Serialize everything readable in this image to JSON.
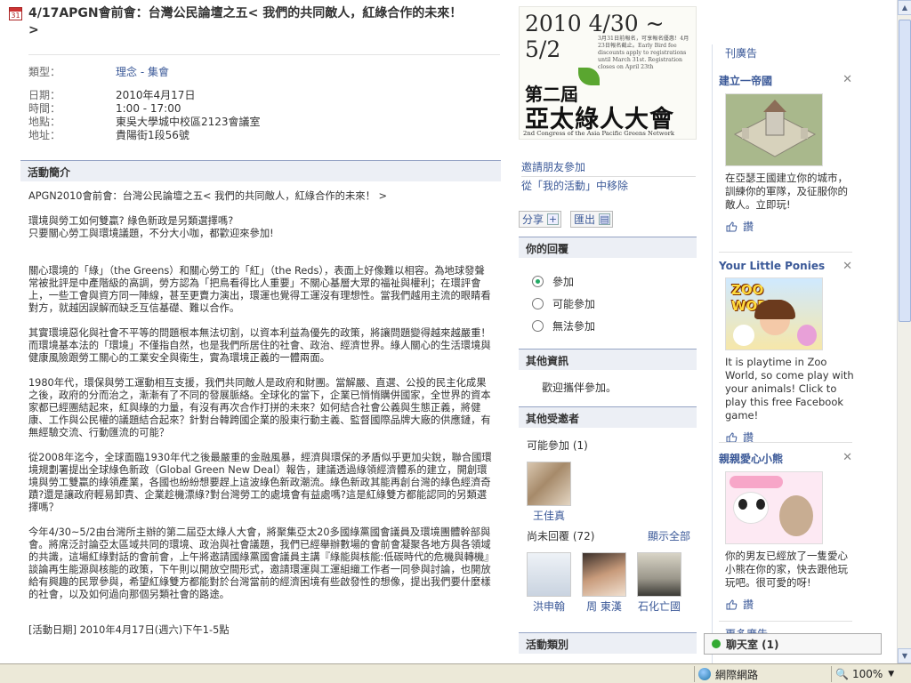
{
  "event": {
    "icon_day": "31",
    "title": "4/17APGN會前會：台灣公民論壇之五< 我們的共同敵人，紅綠合作的未來！ >",
    "fields": [
      {
        "label": "類型：",
        "value": "理念 - 集會",
        "link": true
      },
      {
        "label": "日期：",
        "value": "2010年4月17日",
        "link": false
      },
      {
        "label": "時間：",
        "value": "1:00 - 17:00",
        "link": false
      },
      {
        "label": "地點：",
        "value": "東吳大學城中校區2123會議室",
        "link": false
      },
      {
        "label": "地址：",
        "value": "貴陽街1段56號",
        "link": false
      }
    ]
  },
  "description": {
    "header": "活動簡介",
    "paragraphs": [
      "APGN2010會前會：台灣公民論壇之五< 我們的共同敵人，紅綠合作的未來！ >",
      "環境與勞工如何雙贏? 綠色新政是另類選擇嗎?",
      "只要關心勞工與環境議題，不分大小咖，都歡迎來參加!",
      "關心環境的「綠」（the Greens）和關心勞工的「紅」（the Reds），表面上好像難以相容。為地球發聲常被批評是中產階級的高調，勞方認為「把鳥看得比人重要」不關心基層大眾的福祉與權利；在環評會上，一些工會與資方同一陣線，甚至更賣力演出，環運也覺得工運沒有理想性。當我們越用主流的眼睛看對方，就越因誤解而缺乏互信基礎、難以合作。",
      "其實環境惡化與社會不平等的問題根本無法切割，以資本利益為優先的政策，將讓問題變得越來越嚴重！而環境基本法的「環境」不僅指自然，也是我們所居住的社會、政治、經濟世界。綠人關心的生活環境與健康風險跟勞工關心的工業安全與衛生，實為環境正義的一體兩面。",
      "1980年代，環保與勞工運動相互支援，我們共同敵人是政府和財團。當解嚴、直選、公投的民主化成果之後，政府的分而治之，漸漸有了不同的發展脈絡。全球化的當下，企業已悄悄購併國家，全世界的資本家都已經團結起來，紅與綠的力量，有沒有再次合作打拼的未來？如何結合社會公義與生態正義，將健康、工作與公民權的議題結合起來？針對台韓跨國企業的股東行動主義、監督國際品牌大廠的供應鏈，有無經驗交流、行動匯流的可能？",
      "從2008年迄今，全球面臨1930年代之後最嚴重的金融風暴，經濟與環保的矛盾似乎更加尖銳，聯合國環境規劃署提出全球綠色新政（Global Green New Deal）報告，建議透過綠領經濟體系的建立，開創環境與勞工雙贏的綠領產業，各國也紛紛想要趕上這波綠色新政潮流。綠色新政其能再創台灣的綠色經濟奇蹟?還是讓政府輕易卸責、企業趁機漂綠?對台灣勞工的處境會有益處嗎?這是紅綠雙方都能認同的另類選擇嗎？",
      "今年4/30~5/2由台灣所主辦的第二屆亞太綠人大會，將聚集亞太20多國綠黨國會議員及環境團體幹部與會。將席泛討論亞太區域共同的環境、政治與社會議題，我們已經舉辦數場的會前會凝聚各地方與各領域的共識，這場紅綠對話的會前會，上午將邀請國綠黨國會議員主講『綠能與核能:低碳時代的危機與轉機』談論再生能源與核能的政策，下午則以開放空間形式，邀請環運與工運組織工作者一同參與討論，也開放給有興趣的民眾參與，希望紅綠雙方都能對於台灣當前的經濟困境有些啟發性的想像，提出我們要什麼樣的社會，以及如何過向那個另類社會的路途。",
      "[活動日期] 2010年4月17日(週六)下午1-5點"
    ]
  },
  "poster": {
    "date": "2010 4/30 ~ 5/2",
    "small_text": "3月31日前報名，可享報名優惠！4月23日報名截止。Early Bird fee discounts apply to registrations until March 31st. Registration closes on April 23th",
    "title_1": "第二屆",
    "title_2": "亞太綠人大會",
    "subtitle_en": "2nd Congress of the Asia Pacific Greens Network"
  },
  "actions": {
    "invite": "邀請朋友參加",
    "remove": "從「我的活動」中移除",
    "share": "分享",
    "export": "匯出"
  },
  "rsvp": {
    "header": "你的回覆",
    "options": [
      "參加",
      "可能參加",
      "無法參加"
    ],
    "selected": 0
  },
  "other_info": {
    "header": "其他資訊",
    "text": "歡迎攜伴參加。"
  },
  "guests": {
    "header": "其他受邀者",
    "maybe_label": "可能參加 (1)",
    "maybe": [
      {
        "name": "王佳真"
      }
    ],
    "noreply_label": "尚未回覆 (72)",
    "show_all": "顯示全部",
    "noreply": [
      {
        "name": "洪申翰"
      },
      {
        "name": "周 東漢"
      },
      {
        "name": "石化亡國"
      }
    ]
  },
  "category_header": "活動類別",
  "ads": {
    "label": "刊廣告",
    "like_label": "讚",
    "items": [
      {
        "title": "建立一帝國",
        "text": "在亞瑟王國建立你的城市，訓練你的軍隊，及征服你的敵人。立即玩!"
      },
      {
        "title": "Your Little Ponies",
        "text": "It is playtime in Zoo World, so come play with your animals! Click to play this free Facebook game!",
        "img_text": "ZOO WORLD"
      },
      {
        "title": "親親愛心小熊",
        "text": "你的男友已經放了一隻愛心小熊在你的家，快去跟他玩玩吧。很可愛的呀!"
      }
    ],
    "more": "更多廣告"
  },
  "chat": {
    "label": "聊天室 (1)"
  },
  "statusbar": {
    "zone": "網際網路",
    "zoom": "100%"
  }
}
